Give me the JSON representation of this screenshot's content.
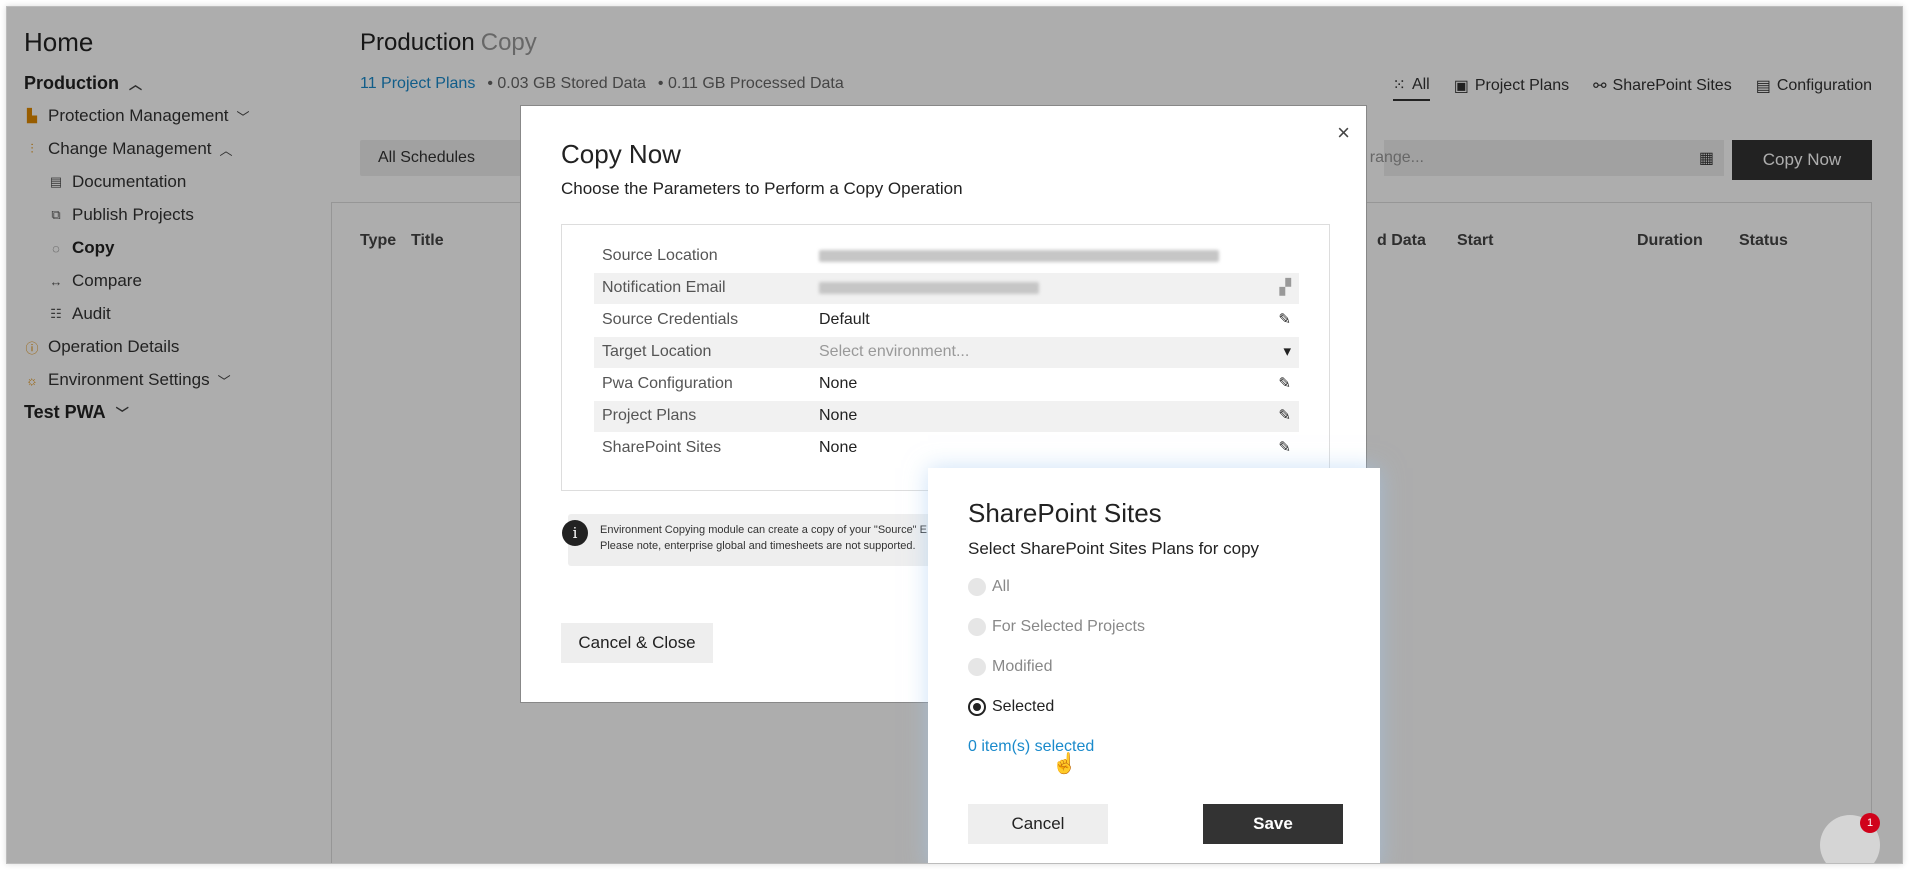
{
  "sidebar": {
    "home": "Home",
    "production": "Production",
    "protection_management": "Protection Management",
    "change_management": "Change Management",
    "documentation": "Documentation",
    "publish_projects": "Publish Projects",
    "copy": "Copy",
    "compare": "Compare",
    "audit": "Audit",
    "operation_details": "Operation Details",
    "environment_settings": "Environment Settings",
    "test_pwa": "Test PWA"
  },
  "header": {
    "title": "Production",
    "subtitle": "Copy",
    "project_plans_link": "11 Project Plans",
    "stored": "• 0.03 GB Stored Data",
    "processed": "• 0.11 GB Processed Data"
  },
  "tabs": {
    "all": "All",
    "project_plans": "Project Plans",
    "sharepoint_sites": "SharePoint Sites",
    "configuration": "Configuration"
  },
  "toolbar": {
    "schedule_filter": "All Schedules",
    "date_placeholder": "range...",
    "copy_now": "Copy Now"
  },
  "grid": {
    "columns": [
      "Type",
      "Title",
      "d Data",
      "Start",
      "Duration",
      "Status"
    ]
  },
  "modal": {
    "title": "Copy Now",
    "subtitle": "Choose the Parameters to Perform a Copy Operation",
    "close": "×",
    "rows": [
      {
        "label": "Source Location",
        "value": ""
      },
      {
        "label": "Notification Email",
        "value": ""
      },
      {
        "label": "Source Credentials",
        "value": "Default"
      },
      {
        "label": "Target Location",
        "value": "Select environment..."
      },
      {
        "label": "Pwa Configuration",
        "value": "None"
      },
      {
        "label": "Project Plans",
        "value": "None"
      },
      {
        "label": "SharePoint Sites",
        "value": "None"
      }
    ],
    "info_line1": "Environment Copying module can create a copy of your \"Source\" E",
    "info_line2": "Please note, enterprise global and timesheets are not supported.",
    "cancel_close": "Cancel & Close"
  },
  "sharepoint_popup": {
    "title": "SharePoint Sites",
    "subtitle": "Select SharePoint Sites Plans for copy",
    "options": [
      "All",
      "For Selected Projects",
      "Modified",
      "Selected"
    ],
    "selected_option": "Selected",
    "items_selected": "0 item(s) selected",
    "cancel": "Cancel",
    "save": "Save"
  },
  "chat": {
    "badge": "1"
  }
}
